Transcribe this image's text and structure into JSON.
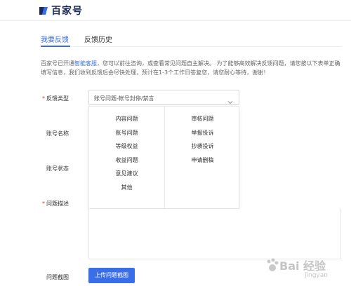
{
  "header": {
    "logo_text": "百家号"
  },
  "tabs": [
    {
      "label": "我要反馈",
      "active": true
    },
    {
      "label": "反馈历史",
      "active": false
    }
  ],
  "notice": {
    "text_before_link": "百家号已开通",
    "link_text": "智能客服",
    "text_after_link": "，您可以前往咨询，或查看常见问题自主解决。 为了能够高效解决反馈问题，请您按以下表单正确填写信息，我们收到反馈后会尽快处理，预计在1-3个工作日答复您，请您耐心等待，谢谢！"
  },
  "form": {
    "feedback_type_label": "反馈类型",
    "feedback_type_value": "账号问题-帐号封停/禁言",
    "account_name_label": "账号名称",
    "account_status_label": "账号状态",
    "description_label": "问题描述",
    "screenshot_label": "问题截图",
    "upload_button": "上传问题截图"
  },
  "dropdown": {
    "left_options": [
      "内容问题",
      "账号问题",
      "等级权益",
      "收益问题",
      "意见建议",
      "其他"
    ],
    "right_options": [
      "审核问题",
      "举报投诉",
      "抄袭投诉",
      "申请删稿"
    ]
  },
  "watermark": {
    "text": "Bai 经验",
    "sub": "jingyan"
  },
  "colors": {
    "accent": "#3a6ee8",
    "required": "#e0363e",
    "brand": "#1d2a57"
  }
}
